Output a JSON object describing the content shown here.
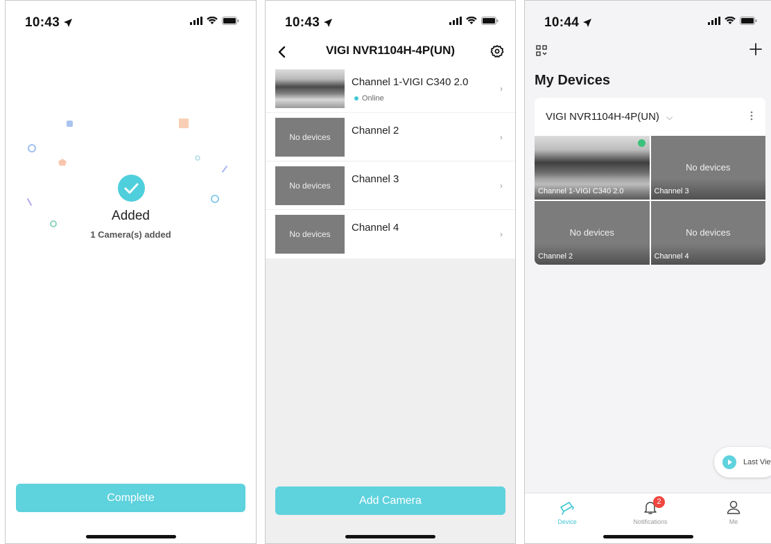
{
  "screen1": {
    "status": {
      "time": "10:43"
    },
    "success_title": "Added",
    "success_subtitle": "1 Camera(s) added",
    "complete_button": "Complete"
  },
  "screen2": {
    "status": {
      "time": "10:43"
    },
    "title": "VIGI NVR1104H-4P(UN)",
    "channels": [
      {
        "name": "Channel 1-VIGI C340 2.0",
        "status": "Online",
        "thumb": ""
      },
      {
        "name": "Channel 2",
        "status": "",
        "thumb": "No devices"
      },
      {
        "name": "Channel 3",
        "status": "",
        "thumb": "No devices"
      },
      {
        "name": "Channel 4",
        "status": "",
        "thumb": "No devices"
      }
    ],
    "add_button": "Add Camera"
  },
  "screen3": {
    "status": {
      "time": "10:44"
    },
    "heading": "My Devices",
    "device_name": "VIGI NVR1104H-4P(UN)",
    "tiles": [
      {
        "label": "Channel 1-VIGI C340 2.0",
        "message": ""
      },
      {
        "label": "Channel 3",
        "message": "No devices"
      },
      {
        "label": "Channel 2",
        "message": "No devices"
      },
      {
        "label": "Channel 4",
        "message": "No devices"
      }
    ],
    "last_view": "Last View",
    "tabs": [
      {
        "label": "Device",
        "icon": "camera-icon",
        "active": true
      },
      {
        "label": "Notifications",
        "icon": "bell-icon",
        "badge": "2"
      },
      {
        "label": "Me",
        "icon": "person-icon"
      }
    ]
  },
  "colors": {
    "accent": "#5ed2dd",
    "badge": "#f0463f",
    "online": "#3ec8d5"
  }
}
